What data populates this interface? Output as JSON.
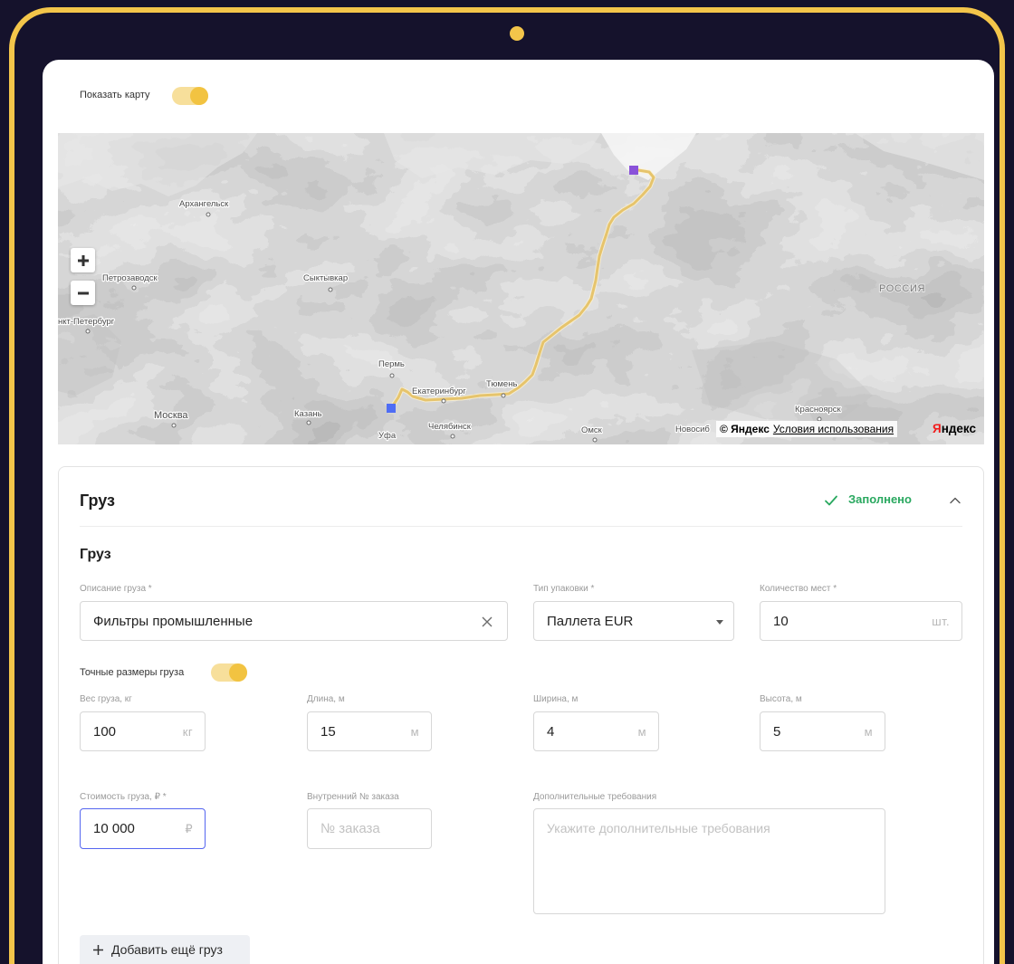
{
  "theme": {
    "background": "#15122c",
    "frame": "#f3c54a",
    "accent": "#f2c341",
    "accent_soft": "#f7df9b",
    "success": "#29a85f",
    "focus": "#5566f0",
    "route": "#e6c46c",
    "marker_start": "#4f6df4",
    "marker_end": "#8a52d9"
  },
  "map_toggle": {
    "label": "Показать карту",
    "on": true
  },
  "map": {
    "cities": [
      "Архангельск",
      "Петрозаводск",
      "Сыктывкар",
      "нкт-Петербург",
      "Пермь",
      "Екатеринбург",
      "Тюмень",
      "Москва",
      "Казань",
      "Уфа",
      "Челябинск",
      "Омск",
      "Красноярск",
      "Новосиб"
    ],
    "country": "РОССИЯ",
    "zoom_in_icon": "plus-icon",
    "zoom_out_icon": "minus-icon",
    "copyright": "© Яндекс",
    "terms": "Условия использования",
    "logo": "Яндекс"
  },
  "cargo": {
    "header_title": "Груз",
    "status": {
      "text": "Заполнено",
      "icon": "check-icon"
    },
    "collapse_icon": "chevron-up-icon",
    "section_title": "Груз",
    "description": {
      "label": "Описание груза *",
      "value": "Фильтры промышленные"
    },
    "packaging": {
      "label": "Тип упаковки *",
      "value": "Паллета EUR"
    },
    "places": {
      "label": "Количество мест *",
      "value": "10",
      "unit": "шт."
    },
    "exact_dimensions": {
      "label": "Точные размеры груза",
      "on": true
    },
    "weight": {
      "label": "Вес груза, кг",
      "value": "100",
      "unit": "кг"
    },
    "length": {
      "label": "Длина, м",
      "value": "15",
      "unit": "м"
    },
    "width": {
      "label": "Ширина, м",
      "value": "4",
      "unit": "м"
    },
    "height": {
      "label": "Высота, м",
      "value": "5",
      "unit": "м"
    },
    "cost": {
      "label": "Стоимость груза, ₽ *",
      "value": "10 000",
      "unit": "₽"
    },
    "order_number": {
      "label": "Внутренний № заказа",
      "placeholder": "№ заказа"
    },
    "extra": {
      "label": "Дополнительные требования",
      "placeholder": "Укажите дополнительные требования"
    },
    "add_button": "Добавить ещё груз"
  }
}
